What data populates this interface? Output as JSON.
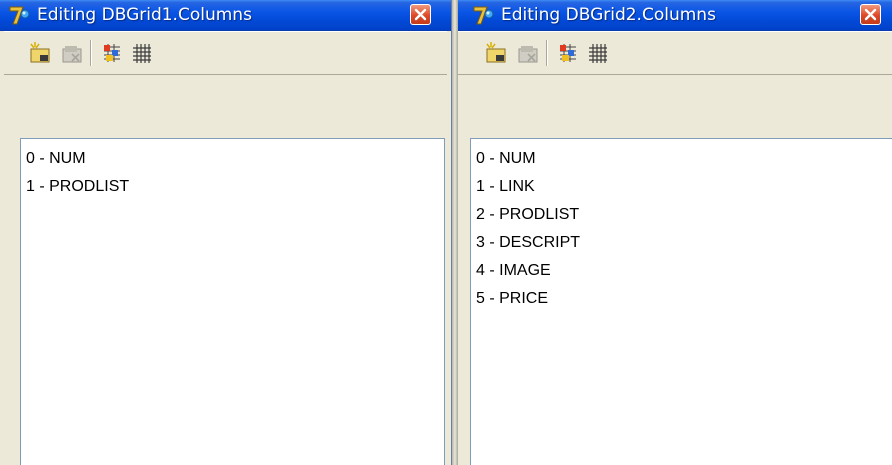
{
  "colors": {
    "titlebar": "#0a55e6",
    "close_button": "#dd4a28",
    "window_face": "#ece9d8",
    "list_background": "#ffffff"
  },
  "windows": [
    {
      "title": "Editing DBGrid1.Columns",
      "toolbar": {
        "buttons": [
          {
            "name": "add-new-column-button",
            "icon": "new-item-icon"
          },
          {
            "name": "delete-column-button",
            "icon": "delete-item-icon"
          },
          {
            "name": "add-all-fields-button",
            "icon": "add-all-fields-icon"
          },
          {
            "name": "restore-defaults-button",
            "icon": "grid-icon"
          }
        ]
      },
      "columns": [
        "0 - NUM",
        "1 - PRODLIST"
      ]
    },
    {
      "title": "Editing DBGrid2.Columns",
      "toolbar": {
        "buttons": [
          {
            "name": "add-new-column-button",
            "icon": "new-item-icon"
          },
          {
            "name": "delete-column-button",
            "icon": "delete-item-icon"
          },
          {
            "name": "add-all-fields-button",
            "icon": "add-all-fields-icon"
          },
          {
            "name": "restore-defaults-button",
            "icon": "grid-icon"
          }
        ]
      },
      "columns": [
        "0 - NUM",
        "1 - LINK",
        "2 - PRODLIST",
        "3 - DESCRIPT",
        "4 - IMAGE",
        "5 - PRICE"
      ]
    }
  ]
}
